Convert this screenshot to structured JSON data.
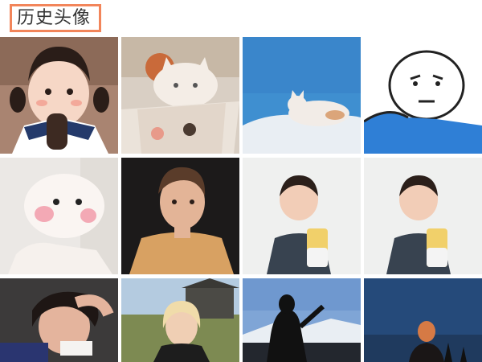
{
  "header": {
    "title": "历史头像"
  },
  "avatars": [
    {
      "subject": "girl-with-pigtails-eating-ice-cream"
    },
    {
      "subject": "white-cat-in-box"
    },
    {
      "subject": "white-cat-under-blue-sky"
    },
    {
      "subject": "cartoon-face-blue-shirt"
    },
    {
      "subject": "fluffy-white-kitten"
    },
    {
      "subject": "young-man-portrait"
    },
    {
      "subject": "toddler-with-juice-bottle"
    },
    {
      "subject": "toddler-with-juice-bottle-2"
    },
    {
      "subject": "girl-with-hand-on-head"
    },
    {
      "subject": "blonde-girl-outdoors"
    },
    {
      "subject": "silhouette-woman-mountains"
    },
    {
      "subject": "girl-silhouette-dusk"
    }
  ],
  "colors": {
    "title_border": "#f2855a",
    "title_text": "#333333"
  }
}
